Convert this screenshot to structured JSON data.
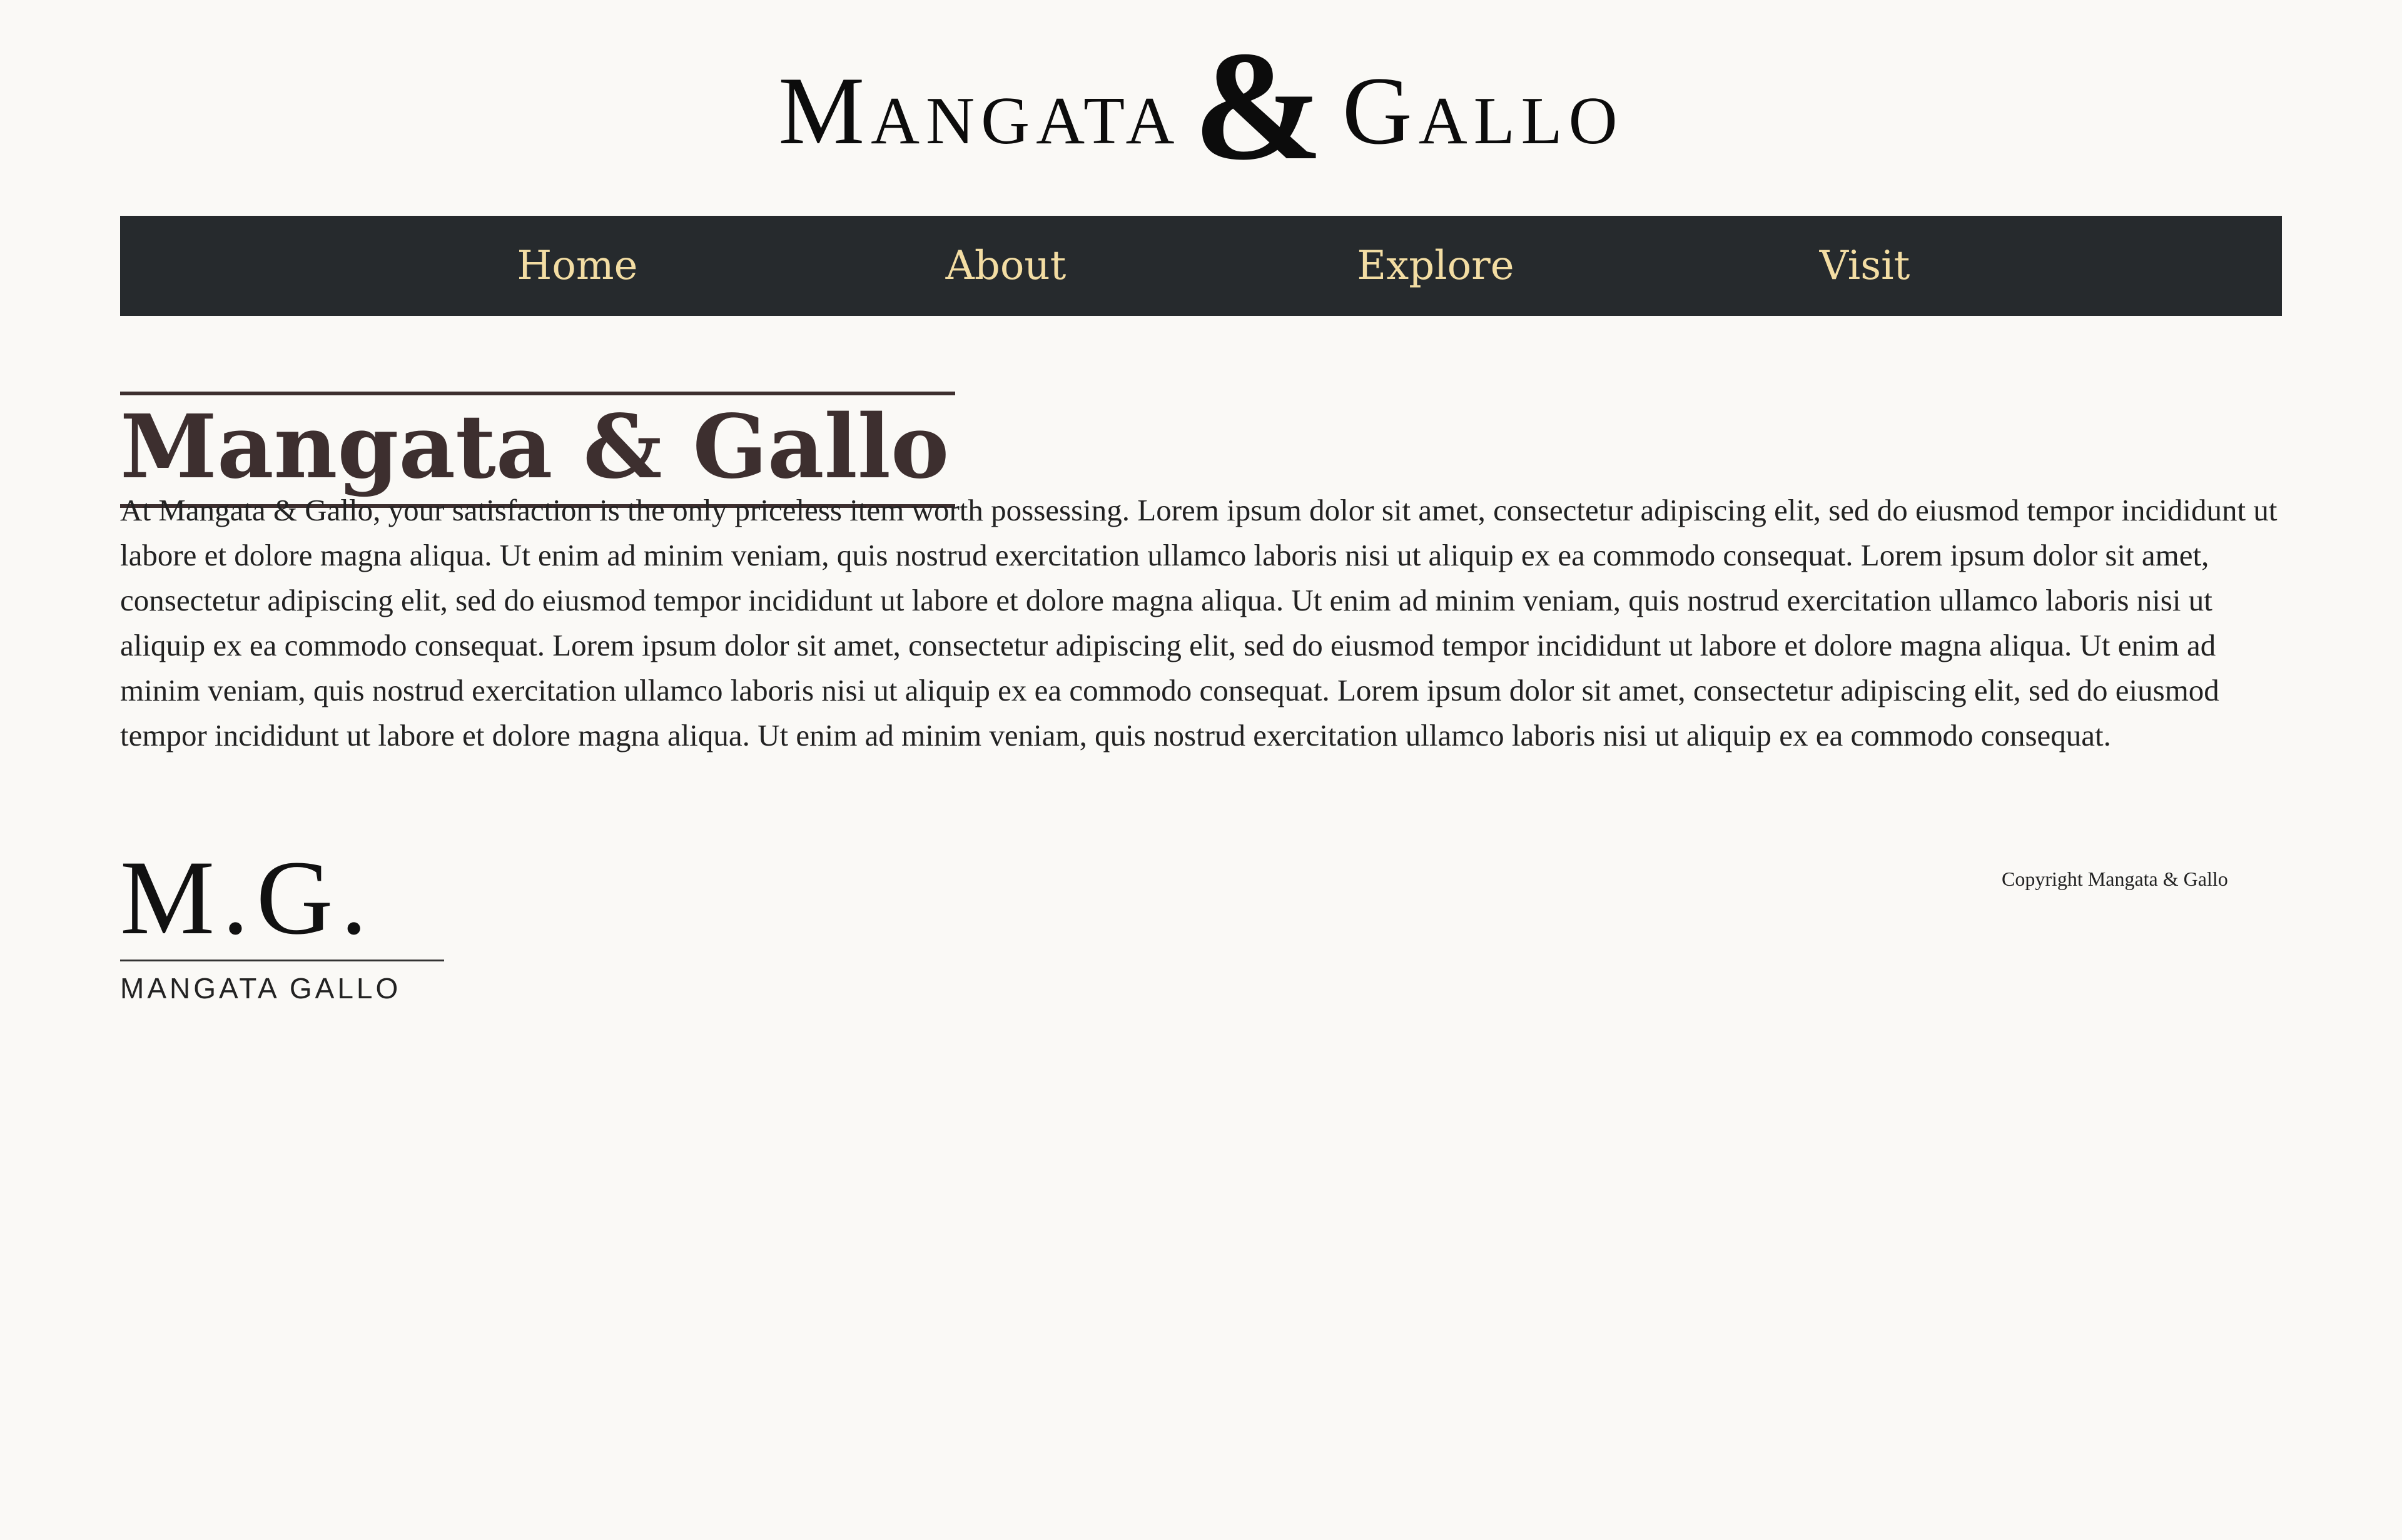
{
  "site": {
    "logo": {
      "word1_initial": "M",
      "word1_rest": "ANGATA",
      "ampersand": "&",
      "word2_initial": "G",
      "word2_rest": "ALLO"
    }
  },
  "nav": {
    "items": [
      {
        "label": "Home"
      },
      {
        "label": "About"
      },
      {
        "label": "Explore"
      },
      {
        "label": "Visit"
      }
    ]
  },
  "main": {
    "heading": "Mangata & Gallo",
    "body": "At Mangata & Gallo, your satisfaction is the only priceless item worth possessing. Lorem ipsum dolor sit amet, consectetur adipiscing elit, sed do eiusmod tempor incididunt ut labore et dolore magna aliqua. Ut enim ad minim veniam, quis nostrud exercitation ullamco laboris nisi ut aliquip ex ea commodo consequat. Lorem ipsum dolor sit amet, consectetur adipiscing elit, sed do eiusmod tempor incididunt ut labore et dolore magna aliqua. Ut enim ad minim veniam, quis nostrud exercitation ullamco laboris nisi ut aliquip ex ea commodo consequat. Lorem ipsum dolor sit amet, consectetur adipiscing elit, sed do eiusmod tempor incididunt ut labore et dolore magna aliqua. Ut enim ad minim veniam, quis nostrud exercitation ullamco laboris nisi ut aliquip ex ea commodo consequat. Lorem ipsum dolor sit amet, consectetur adipiscing elit, sed do eiusmod tempor incididunt ut labore et dolore magna aliqua. Ut enim ad minim veniam, quis nostrud exercitation ullamco laboris nisi ut aliquip ex ea commodo consequat."
  },
  "footer": {
    "logo_mark": "M.G.",
    "logo_text": "MANGATA GALLO",
    "copyright": "Copyright Mangata & Gallo"
  },
  "colors": {
    "background": "#faf9f6",
    "nav_background": "#262a2d",
    "nav_text": "#f3dda3",
    "heading": "#3d2f2f"
  }
}
